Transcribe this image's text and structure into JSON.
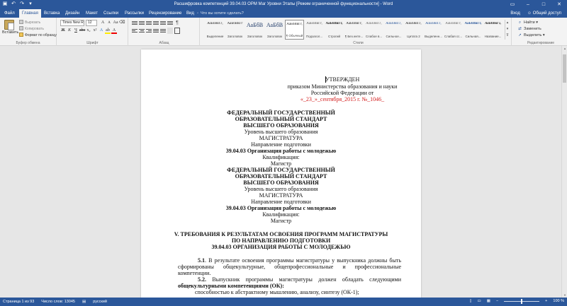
{
  "title_bar": {
    "title": "Расшифровка компетенций 39.04.03 OPM Маг Уровни Этапы [Режим ограниченной функциональности] - Word"
  },
  "tabs": [
    "Файл",
    "Главная",
    "Вставка",
    "Дизайн",
    "Макет",
    "Ссылки",
    "Рассылки",
    "Рецензирование",
    "Вид"
  ],
  "tell_me": "Что вы хотите сделать?",
  "account": {
    "sign_in": "Вход",
    "share": "Общий доступ"
  },
  "ribbon": {
    "clipboard": {
      "paste": "Вставить",
      "cut": "Вырезать",
      "copy": "Копировать",
      "format_painter": "Формат по образцу",
      "label": "Буфер обмена"
    },
    "font": {
      "name": "Times New R",
      "size": "12",
      "label": "Шрифт"
    },
    "paragraph": {
      "label": "Абзац"
    },
    "styles": {
      "label": "Стили",
      "items": [
        {
          "sample": "АаБбВвГг,",
          "name": "Выделение"
        },
        {
          "sample": "АаБбВвГг",
          "name": "Заголовок"
        },
        {
          "sample": "АаБбВ",
          "name": "Заголовок"
        },
        {
          "sample": "АаБбВ",
          "name": "Заголовок"
        },
        {
          "sample": "АаБбВвГг,",
          "name": "¶ Обычный"
        },
        {
          "sample": "АаБбВвГг,",
          "name": "Подзагол..."
        },
        {
          "sample": "АаБбВвГг,",
          "name": "Строгий"
        },
        {
          "sample": "АаБбВвГг,",
          "name": "¶ Без инте..."
        },
        {
          "sample": "АаБбВвГг,",
          "name": "Слабое в..."
        },
        {
          "sample": "АаБбВвГг,",
          "name": "Сильное..."
        },
        {
          "sample": "АаБбВвГг,",
          "name": "Цитата 2"
        },
        {
          "sample": "АаБбВвГг,",
          "name": "Выделенн..."
        },
        {
          "sample": "АаБбВвГг,",
          "name": "Слабая сс..."
        },
        {
          "sample": "АаБбВвГг,",
          "name": "Сильная..."
        },
        {
          "sample": "АаБбВвГг,",
          "name": "Название..."
        }
      ]
    },
    "editing": {
      "find": "Найти",
      "replace": "Заменить",
      "select": "Выделить",
      "label": "Редактирование"
    }
  },
  "document": {
    "approved": {
      "title": "УТВЕРЖДЕН",
      "line1": "приказом Министерства образования и науки",
      "line2": "Российской Федерации от",
      "date": "«_23_»_сентября_2015 г. №_1046_"
    },
    "block1": [
      "ФЕДЕРАЛЬНЫЙ ГОСУДАРСТВЕННЫЙ",
      "ОБРАЗОВАТЕЛЬНЫЙ СТАНДАРТ",
      "ВЫСШЕГО ОБРАЗОВАНИЯ",
      "Уровень высшего образования",
      "МАГИСТРАТУРА",
      "Направление подготовки",
      "39.04.03 Организация работы с молодежью",
      "Квалификация:",
      "Магистр"
    ],
    "block2": [
      "ФЕДЕРАЛЬНЫЙ ГОСУДАРСТВЕННЫЙ",
      "ОБРАЗОВАТЕЛЬНЫЙ СТАНДАРТ",
      "ВЫСШЕГО ОБРАЗОВАНИЯ",
      "Уровень высшего образования",
      "МАГИСТРАТУРА",
      "Направление подготовки",
      "39.04.03 Организация работы с молодежью",
      "Квалификация:",
      "Магистр"
    ],
    "section_heading": [
      "V. ТРЕБОВАНИЯ К РЕЗУЛЬТАТАМ ОСВОЕНИЯ ПРОГРАММ МАГИСТРАТУРЫ",
      "ПО НАПРАВЛЕНИЮ ПОДГОТОВКИ",
      "39.04.03 ОРГАНИЗАЦИЯ РАБОТЫ С МОЛОДЕЖЬЮ"
    ],
    "para51": {
      "num": "5.1",
      "line1": ". В результате освоения программы магистратуры у выпускника должны быть",
      "line2": "сформированы общекультурные, общепрофессиональные и профессиональные",
      "line3": "компетенции."
    },
    "para52": {
      "num": "5.2.",
      "line1": " Выпускник программы магистратуры должен обладать следующими",
      "line2": "общекультурными компетенциями (ОК):",
      "line3": "способностью к абстрактному мышлению, анализу, синтезу (ОК-1);"
    }
  },
  "status_bar": {
    "page": "Страница 1 из 93",
    "words": "Число слов: 13045",
    "language": "русский",
    "zoom": "100 %"
  }
}
